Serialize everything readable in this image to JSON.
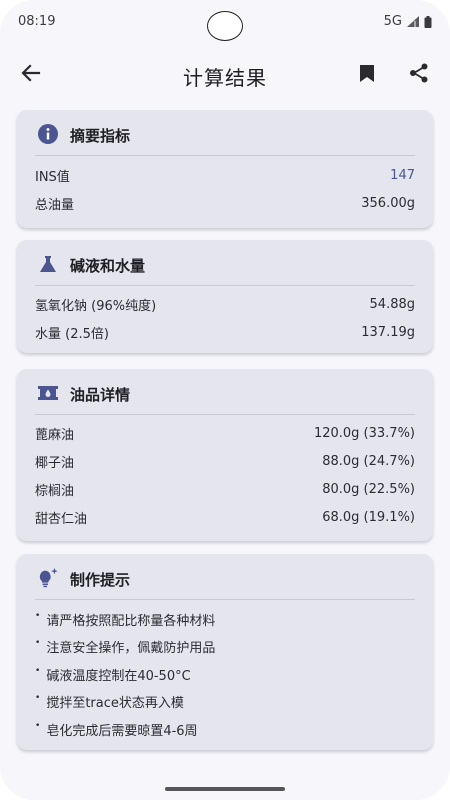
{
  "status": {
    "time": "08:19",
    "network": "5G"
  },
  "header": {
    "title": "计算结果"
  },
  "summary": {
    "title": "摘要指标",
    "rows": [
      {
        "label": "INS值",
        "value": "147"
      },
      {
        "label": "总油量",
        "value": "356.00g"
      }
    ]
  },
  "lye": {
    "title": "碱液和水量",
    "rows": [
      {
        "label": "氢氧化钠 (96%纯度)",
        "value": "54.88g"
      },
      {
        "label": "水量 (2.5倍)",
        "value": "137.19g"
      }
    ]
  },
  "oils": {
    "title": "油品详情",
    "rows": [
      {
        "label": "蓖麻油",
        "value": "120.0g (33.7%)"
      },
      {
        "label": "椰子油",
        "value": "88.0g (24.7%)"
      },
      {
        "label": "棕榈油",
        "value": "80.0g (22.5%)"
      },
      {
        "label": "甜杏仁油",
        "value": "68.0g (19.1%)"
      }
    ]
  },
  "tips": {
    "title": "制作提示",
    "items": [
      "请严格按照配比称量各种材料",
      "注意安全操作，佩戴防护用品",
      "碱液温度控制在40-50°C",
      "搅拌至trace状态再入模",
      "皂化完成后需要晾置4-6周"
    ]
  },
  "colors": {
    "accent": "#4a5591",
    "card": "#e5e5ee",
    "background": "#f6f6fb"
  }
}
